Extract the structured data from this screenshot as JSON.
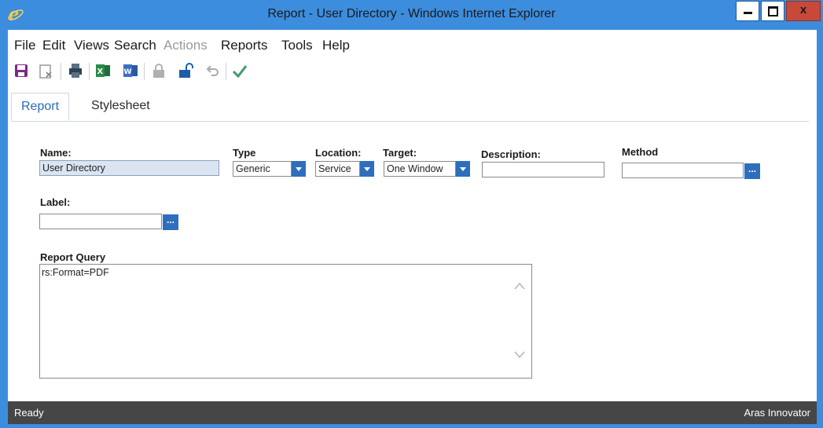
{
  "window": {
    "title": "Report - User Directory - Windows Internet Explorer",
    "close_label": "x"
  },
  "menu": {
    "items": [
      {
        "label": "File"
      },
      {
        "label": "Edit"
      },
      {
        "label": "Views"
      },
      {
        "label": "Search"
      },
      {
        "label": "Actions",
        "disabled": true
      },
      {
        "label": "Reports"
      },
      {
        "label": "Tools"
      },
      {
        "label": "Help"
      }
    ]
  },
  "toolbar": {
    "icons": [
      "save-icon",
      "discard-icon",
      "print-icon",
      "excel-icon",
      "word-icon",
      "lock-icon",
      "unlock-icon",
      "undo-icon",
      "done-icon"
    ]
  },
  "tabs": [
    {
      "label": "Report",
      "active": true
    },
    {
      "label": "Stylesheet",
      "active": false
    }
  ],
  "form": {
    "name_label": "Name:",
    "name_value": "User Directory",
    "type_label": "Type",
    "type_value": "Generic",
    "location_label": "Location:",
    "location_value": "Service",
    "target_label": "Target:",
    "target_value": "One Window",
    "description_label": "Description:",
    "description_value": "",
    "method_label": "Method",
    "method_value": "",
    "label_label": "Label:",
    "label_value": "",
    "query_label": "Report Query",
    "query_value": "rs:Format=PDF",
    "ellipsis": "..."
  },
  "status": {
    "left": "Ready",
    "right": "Aras Innovator"
  },
  "colors": {
    "titlebar": "#3c8dde",
    "accent": "#2e6fbd",
    "statusbar": "#464646",
    "close": "#c7493a"
  }
}
